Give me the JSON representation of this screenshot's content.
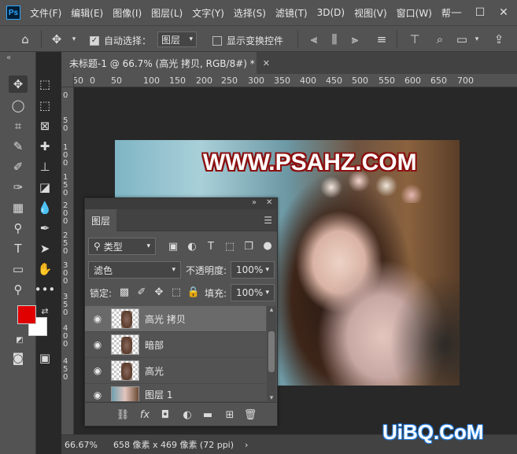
{
  "app": {
    "logo_text": "Ps"
  },
  "menubar": {
    "items": [
      "文件(F)",
      "编辑(E)",
      "图像(I)",
      "图层(L)",
      "文字(Y)",
      "选择(S)",
      "滤镜(T)",
      "3D(D)",
      "视图(V)",
      "窗口(W)",
      "帮"
    ]
  },
  "options": {
    "auto_select_label": "自动选择：",
    "auto_select_value": "图层",
    "show_transform_label": "显示变换控件"
  },
  "document": {
    "tab_title": "未标题-1 @ 66.7% (高光 拷贝, RGB/8#) *"
  },
  "ruler": {
    "top_labels": [
      "50",
      "0",
      "50",
      "100",
      "150",
      "200",
      "250",
      "300",
      "350",
      "400",
      "450",
      "500",
      "550",
      "600",
      "650",
      "700"
    ],
    "left_labels": [
      "0",
      "50",
      "100",
      "150",
      "200",
      "250",
      "300",
      "350",
      "400",
      "450"
    ]
  },
  "canvas": {
    "watermark": "WWW.PSAHZ.COM"
  },
  "layers_panel": {
    "tab_label": "图层",
    "filter_kind": "类型",
    "blend_mode": "滤色",
    "opacity_label": "不透明度:",
    "opacity_value": "100%",
    "lock_label": "锁定:",
    "fill_label": "填充:",
    "fill_value": "100%",
    "layers": [
      {
        "name": "高光 拷贝",
        "selected": true
      },
      {
        "name": "暗部",
        "selected": false
      },
      {
        "name": "高光",
        "selected": false
      },
      {
        "name": "图层 1",
        "selected": false
      }
    ]
  },
  "statusbar": {
    "zoom": "66.67%",
    "doc_info": "658 像素 x 469 像素 (72 ppi)"
  },
  "colors": {
    "foreground": "#e00000",
    "background": "#ffffff"
  },
  "corner_logo": "UiBQ.CoM"
}
